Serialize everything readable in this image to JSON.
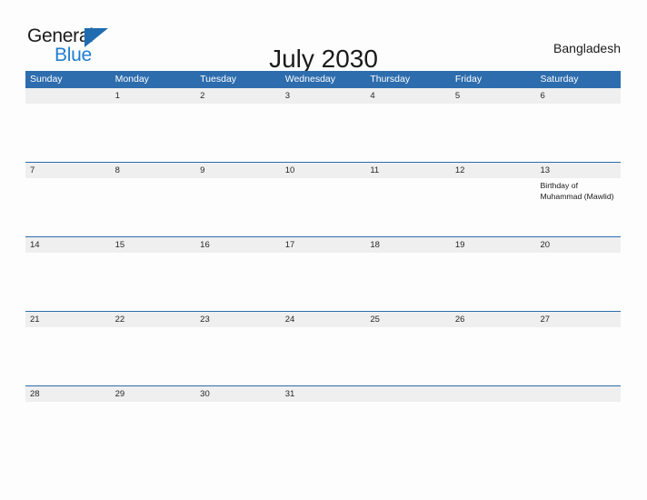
{
  "brand": {
    "name_part1": "General",
    "name_part2": "Blue",
    "logo_icon": "triangle-flag-icon",
    "accent_dark": "#1f6cb0",
    "accent_light": "#1f7ed0"
  },
  "header": {
    "title": "July 2030",
    "region": "Bangladesh"
  },
  "colors": {
    "header_blue": "#2d6dae",
    "band_gray": "#efefef",
    "rule_blue": "#2d6dae",
    "page_background": "#fdfdfd",
    "text": "#1b1b1b"
  },
  "calendar": {
    "weekdays": [
      "Sunday",
      "Monday",
      "Tuesday",
      "Wednesday",
      "Thursday",
      "Friday",
      "Saturday"
    ],
    "weeks": [
      {
        "days": [
          {
            "number": "",
            "events": []
          },
          {
            "number": "1",
            "events": []
          },
          {
            "number": "2",
            "events": []
          },
          {
            "number": "3",
            "events": []
          },
          {
            "number": "4",
            "events": []
          },
          {
            "number": "5",
            "events": []
          },
          {
            "number": "6",
            "events": []
          }
        ]
      },
      {
        "days": [
          {
            "number": "7",
            "events": []
          },
          {
            "number": "8",
            "events": []
          },
          {
            "number": "9",
            "events": []
          },
          {
            "number": "10",
            "events": []
          },
          {
            "number": "11",
            "events": []
          },
          {
            "number": "12",
            "events": []
          },
          {
            "number": "13",
            "events": [
              "Birthday of Muhammad (Mawlid)"
            ]
          }
        ]
      },
      {
        "days": [
          {
            "number": "14",
            "events": []
          },
          {
            "number": "15",
            "events": []
          },
          {
            "number": "16",
            "events": []
          },
          {
            "number": "17",
            "events": []
          },
          {
            "number": "18",
            "events": []
          },
          {
            "number": "19",
            "events": []
          },
          {
            "number": "20",
            "events": []
          }
        ]
      },
      {
        "days": [
          {
            "number": "21",
            "events": []
          },
          {
            "number": "22",
            "events": []
          },
          {
            "number": "23",
            "events": []
          },
          {
            "number": "24",
            "events": []
          },
          {
            "number": "25",
            "events": []
          },
          {
            "number": "26",
            "events": []
          },
          {
            "number": "27",
            "events": []
          }
        ]
      },
      {
        "days": [
          {
            "number": "28",
            "events": []
          },
          {
            "number": "29",
            "events": []
          },
          {
            "number": "30",
            "events": []
          },
          {
            "number": "31",
            "events": []
          },
          {
            "number": "",
            "events": []
          },
          {
            "number": "",
            "events": []
          },
          {
            "number": "",
            "events": []
          }
        ]
      }
    ]
  }
}
